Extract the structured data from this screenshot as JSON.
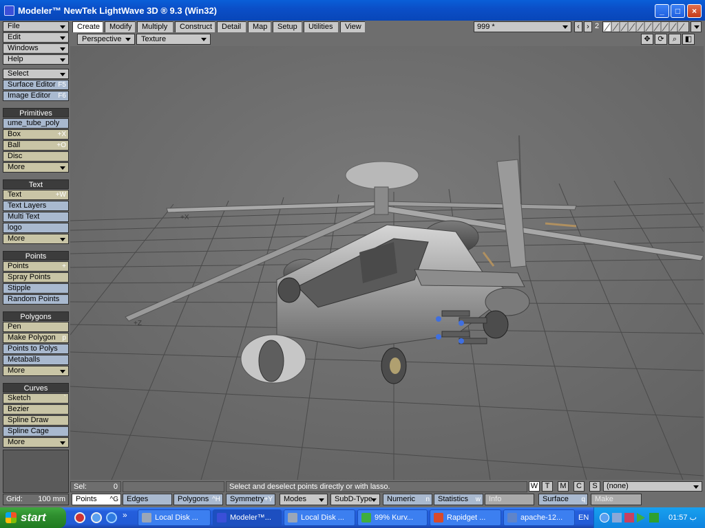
{
  "window": {
    "title": "Modeler™ NewTek LightWave 3D ® 9.3 (Win32)",
    "minimize": "_",
    "maximize": "□",
    "close": "×"
  },
  "left_menu": {
    "file": "File",
    "edit": "Edit",
    "windows": "Windows",
    "help": "Help",
    "select": "Select",
    "surface_editor": "Surface Editor",
    "surface_editor_sc": "F5",
    "image_editor": "Image Editor",
    "image_editor_sc": "F6",
    "primitives": {
      "header": "Primitives",
      "items": [
        {
          "label": "ume_tube_poly",
          "sc": ""
        },
        {
          "label": "Box",
          "sc": "+X"
        },
        {
          "label": "Ball",
          "sc": "+O"
        },
        {
          "label": "Disc",
          "sc": ""
        },
        {
          "label": "More",
          "sc": ""
        }
      ]
    },
    "text": {
      "header": "Text",
      "items": [
        {
          "label": "Text",
          "sc": "+W"
        },
        {
          "label": "Text Layers",
          "sc": ""
        },
        {
          "label": "Multi Text",
          "sc": ""
        },
        {
          "label": "logo",
          "sc": ""
        },
        {
          "label": "More",
          "sc": ""
        }
      ]
    },
    "points": {
      "header": "Points",
      "items": [
        {
          "label": "Points",
          "sc": "+"
        },
        {
          "label": "Spray Points",
          "sc": ""
        },
        {
          "label": "Stipple",
          "sc": ""
        },
        {
          "label": "Random Points",
          "sc": ""
        }
      ]
    },
    "polygons": {
      "header": "Polygons",
      "items": [
        {
          "label": "Pen",
          "sc": ""
        },
        {
          "label": "Make Polygon",
          "sc": "p"
        },
        {
          "label": "Points to Polys",
          "sc": ""
        },
        {
          "label": "Metaballs",
          "sc": ""
        },
        {
          "label": "More",
          "sc": ""
        }
      ]
    },
    "curves": {
      "header": "Curves",
      "items": [
        {
          "label": "Sketch",
          "sc": "`"
        },
        {
          "label": "Bezier",
          "sc": ""
        },
        {
          "label": "Spline Draw",
          "sc": ""
        },
        {
          "label": "Spline Cage",
          "sc": ""
        },
        {
          "label": "More",
          "sc": ""
        }
      ]
    }
  },
  "tabs": [
    "Create",
    "Modify",
    "Multiply",
    "Construct",
    "Detail",
    "Map",
    "Setup",
    "Utilities",
    "View"
  ],
  "layer_select": "999 *",
  "layer_num": "2",
  "viewport": {
    "view": "Perspective",
    "mode": "Texture",
    "axis_x": "+X",
    "axis_z": "+Z"
  },
  "status": {
    "sel_label": "Sel:",
    "sel_value": "0",
    "message": "Select and deselect points directly or with lasso.",
    "wtmcs": [
      "W",
      "T",
      "M",
      "C",
      "S"
    ],
    "surface_select": "(none)",
    "grid_label": "Grid:",
    "grid_value": "100 mm"
  },
  "modes": {
    "points": "Points",
    "points_sc": "^G",
    "edges": "Edges",
    "polygons": "Polygons",
    "polygons_sc": "^H",
    "symmetry": "Symmetry",
    "symmetry_sc": "+Y",
    "modes": "Modes",
    "subd": "SubD-Type",
    "numeric": "Numeric",
    "numeric_sc": "n",
    "statistics": "Statistics",
    "statistics_sc": "w",
    "info": "Info",
    "surface": "Surface",
    "surface_sc": "q",
    "make": "Make"
  },
  "taskbar": {
    "start": "start",
    "tasks": [
      {
        "label": "Local Disk ...",
        "color": "#9aa6b8"
      },
      {
        "label": "Modeler™...",
        "color": "#3a4fd8"
      },
      {
        "label": "Local Disk ...",
        "color": "#9aa6b8"
      },
      {
        "label": "99% Kurv...",
        "color": "#3fae3f"
      },
      {
        "label": "Rapidget ...",
        "color": "#d84a2a"
      },
      {
        "label": "apache-12...",
        "color": "#5f84c9"
      }
    ],
    "lang": "EN",
    "clock": "01:57 ب"
  }
}
